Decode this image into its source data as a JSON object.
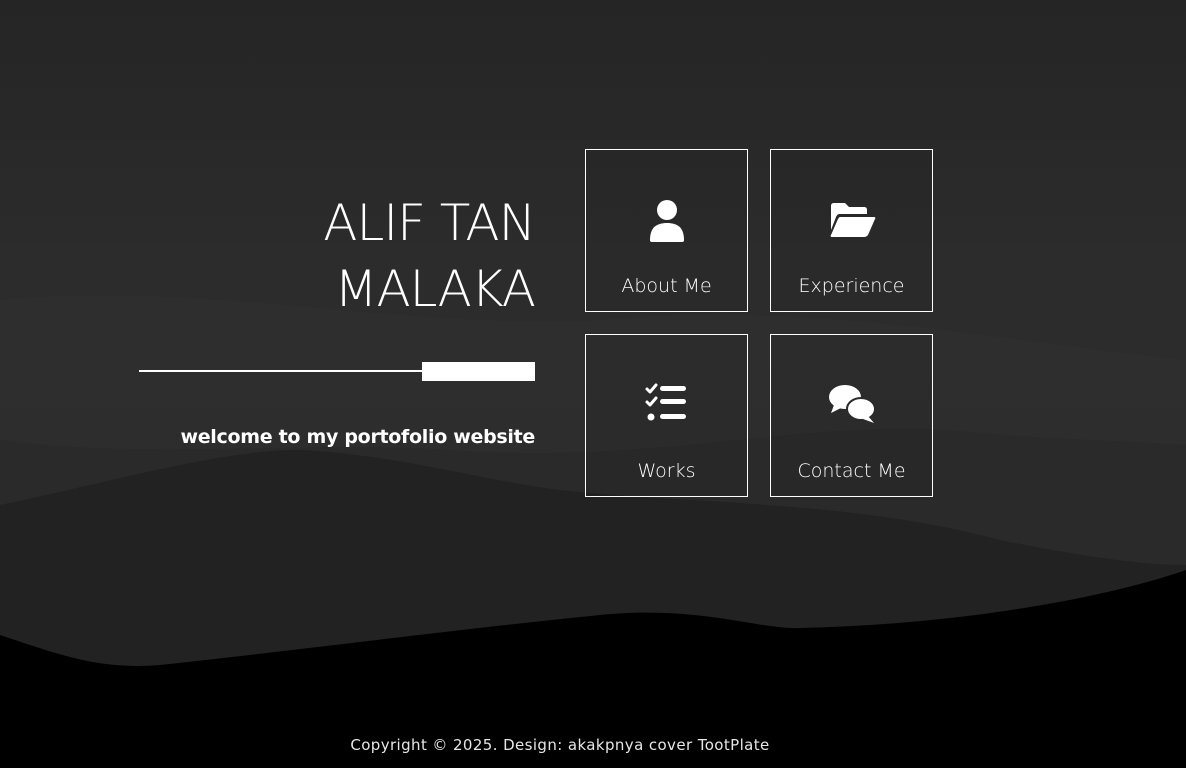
{
  "site": {
    "title_line1": "ALIF TAN",
    "title_line2": "MALAKA",
    "tagline": "welcome to my portofolio website"
  },
  "nav": {
    "tiles": [
      {
        "label": "About Me",
        "icon": "user-icon"
      },
      {
        "label": "Experience",
        "icon": "folder-open-icon"
      },
      {
        "label": "Works",
        "icon": "checklist-icon"
      },
      {
        "label": "Contact Me",
        "icon": "chat-bubbles-icon"
      }
    ]
  },
  "footer": {
    "copyright": "Copyright © 2025. Design: akakpnya cover TootPlate"
  },
  "colors": {
    "background": "#262626",
    "text": "#ffffff",
    "tile_border": "#ffffff"
  }
}
